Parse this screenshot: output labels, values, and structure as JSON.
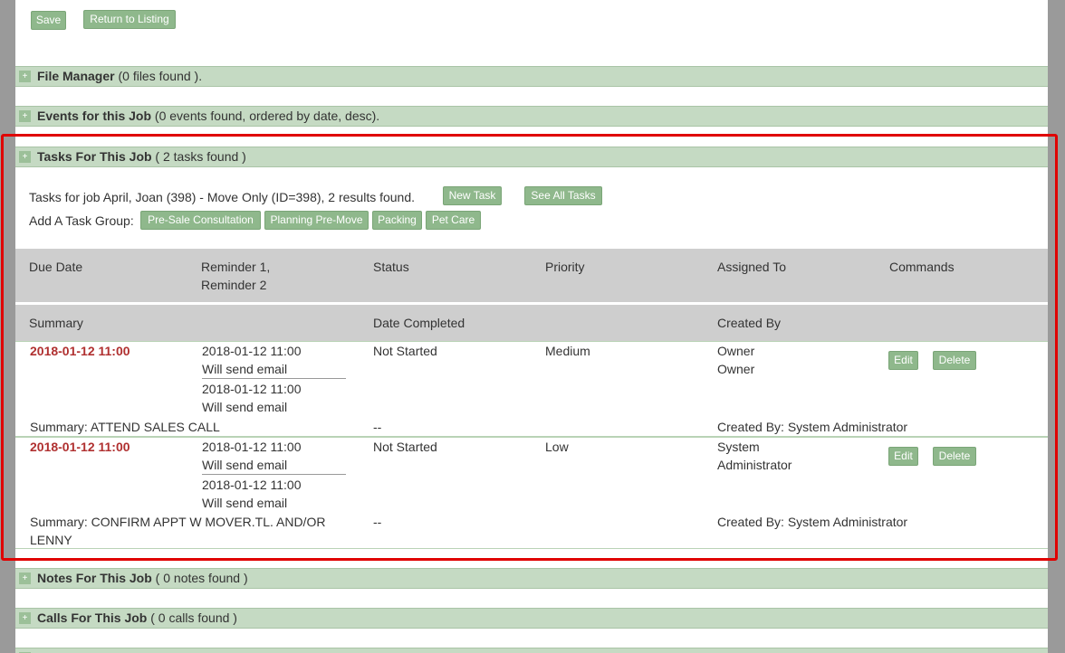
{
  "toolbar": {
    "save_label": "Save",
    "return_label": "Return to Listing"
  },
  "sections": {
    "file_manager": {
      "title": "File Manager",
      "count": " (0 files found )."
    },
    "events": {
      "title": "Events for this Job",
      "count": " (0 events found, ordered by date, desc)."
    },
    "tasks": {
      "title": "Tasks For This Job",
      "count": " ( 2 tasks found )"
    },
    "notes": {
      "title": "Notes For This Job",
      "count": " ( 0 notes found )"
    },
    "calls": {
      "title": "Calls For This Job",
      "count": " ( 0 calls found )"
    }
  },
  "tasks_panel": {
    "intro": "Tasks for job April, Joan (398) - Move Only (ID=398), 2 results found.",
    "new_task_label": "New Task",
    "see_all_label": "See All Tasks",
    "group_label": "Add A Task Group:",
    "groups": [
      "Pre-Sale Consultation",
      "Planning Pre-Move",
      "Packing",
      "Pet Care"
    ],
    "headers": {
      "due_date": "Due Date",
      "reminder_1": "Reminder 1,",
      "reminder_2": "Reminder 2",
      "status": "Status",
      "priority": "Priority",
      "assigned_to": "Assigned To",
      "commands": "Commands",
      "summary": "Summary",
      "date_completed": "Date Completed",
      "created_by": "Created By"
    },
    "rows": [
      {
        "due": "2018-01-12 11:00",
        "r1_date": "2018-01-12 11:00",
        "r1_note": "Will send email",
        "r2_date": "2018-01-12 11:00",
        "r2_note": "Will send email",
        "status": "Not Started",
        "priority": "Medium",
        "assigned_1": "Owner",
        "assigned_2": "Owner",
        "edit": "Edit",
        "delete": "Delete",
        "summary_1": "Summary: ATTEND SALES CALL",
        "summary_2": "",
        "completed": "--",
        "created_by": "Created By: System Administrator"
      },
      {
        "due": "2018-01-12 11:00",
        "r1_date": "2018-01-12 11:00",
        "r1_note": "Will send email",
        "r2_date": "2018-01-12 11:00",
        "r2_note": "Will send email",
        "status": "Not Started",
        "priority": "Low",
        "assigned_1": "System",
        "assigned_2": "Administrator",
        "edit": "Edit",
        "delete": "Delete",
        "summary_1": "Summary: CONFIRM APPT W MOVER.TL. AND/OR",
        "summary_2": "LENNY",
        "completed": "--",
        "created_by": "Created By: System Administrator"
      }
    ]
  },
  "colors": {
    "accent_green": "#8fb88c",
    "section_bar": "#c5dac3",
    "due_red": "#b03030",
    "highlight": "#e00000"
  }
}
